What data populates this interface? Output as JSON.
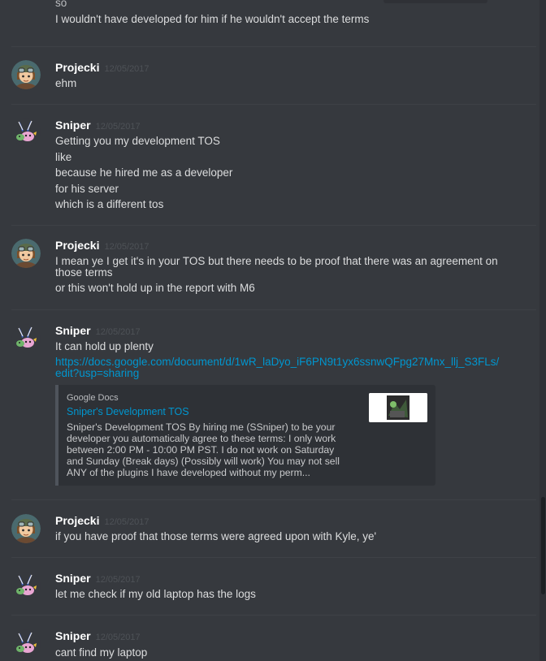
{
  "continuation": {
    "clipped_text": "so",
    "text": "I wouldn't have developed for him if he wouldn't accept the terms"
  },
  "messages": [
    {
      "author": "Projecki",
      "timestamp": "12/05/2017",
      "avatar": "projecki-avatar",
      "lines": [
        "ehm"
      ]
    },
    {
      "author": "Sniper",
      "timestamp": "12/05/2017",
      "avatar": "sniper-avatar",
      "lines": [
        "Getting you my development TOS",
        "like",
        "because he hired me as a developer",
        "for his server",
        "which is a different tos"
      ]
    },
    {
      "author": "Projecki",
      "timestamp": "12/05/2017",
      "avatar": "projecki-avatar",
      "lines": [
        "I mean ye I get it's in your TOS but there needs to be proof that there was an agreement on those terms",
        "or this won't hold up in the report with M6"
      ]
    },
    {
      "author": "Sniper",
      "timestamp": "12/05/2017",
      "avatar": "sniper-avatar",
      "lines": [
        "It can hold up plenty"
      ],
      "link": "https://docs.google.com/document/d/1wR_laDyo_iF6PN9t1yx6ssnwQFpg27Mnx_llj_S3FLs/edit?usp=sharing",
      "embed": {
        "provider": "Google Docs",
        "title": "Sniper's Development TOS",
        "description": "Sniper's Development TOS  By hiring me (SSniper) to be your developer you automatically agree to these terms:  I only work between 2:00 PM - 10:00 PM PST. I do not work on Saturday and Sunday (Break days) (Possibly will work) You may not sell ANY of the plugins I have developed without my perm..."
      }
    },
    {
      "author": "Projecki",
      "timestamp": "12/05/2017",
      "avatar": "projecki-avatar",
      "lines": [
        "if you have proof that those terms were agreed upon with Kyle, ye'"
      ]
    },
    {
      "author": "Sniper",
      "timestamp": "12/05/2017",
      "avatar": "sniper-avatar",
      "lines": [
        "let me check if my old laptop has the logs"
      ]
    },
    {
      "author": "Sniper",
      "timestamp": "12/05/2017",
      "avatar": "sniper-avatar",
      "lines": [
        "cant find my laptop"
      ]
    }
  ],
  "colors": {
    "background": "#36393e",
    "username": "#ffffff",
    "timestamp": "#4e5257",
    "link": "#0096cf"
  }
}
